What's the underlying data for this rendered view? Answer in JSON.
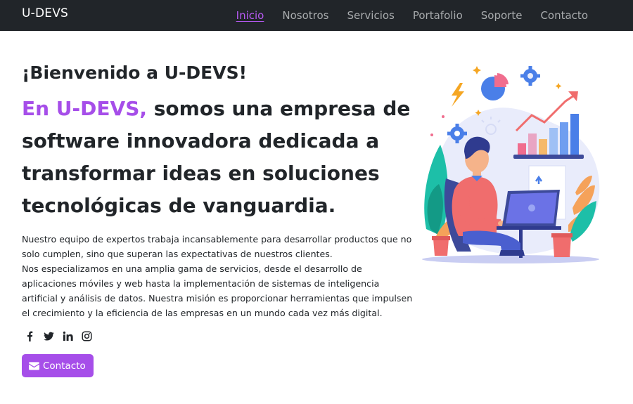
{
  "navbar": {
    "brand": "U-DEVS",
    "links": [
      {
        "label": "Inicio",
        "active": true
      },
      {
        "label": "Nosotros",
        "active": false
      },
      {
        "label": "Servicios",
        "active": false
      },
      {
        "label": "Portafolio",
        "active": false
      },
      {
        "label": "Soporte",
        "active": false
      },
      {
        "label": "Contacto",
        "active": false
      }
    ]
  },
  "hero": {
    "welcome": "¡Bienvenido a U-DEVS!",
    "headline_accent": "En U-DEVS,",
    "headline_rest": " somos una empresa de software innovadora dedicada a transformar ideas en soluciones tecnológicas de vanguardia.",
    "paragraph_1": "Nuestro equipo de expertos trabaja incansablemente para desarrollar productos que no solo cumplen, sino que superan las expectativas de nuestros clientes.",
    "paragraph_2": "Nos especializamos en una amplia gama de servicios, desde el desarrollo de aplicaciones móviles y web hasta la implementación de sistemas de inteligencia artificial y análisis de datos. Nuestra misión es proporcionar herramientas que impulsen el crecimiento y la eficiencia de las empresas en un mundo cada vez más digital.",
    "social_icons": [
      "facebook-icon",
      "twitter-icon",
      "linkedin-icon",
      "instagram-icon"
    ],
    "cta_label": "Contacto",
    "cta_icon": "envelope-icon"
  },
  "colors": {
    "navbar_bg": "#212529",
    "accent": "#a64ee9",
    "nav_link": "#a8abad",
    "text": "#212529"
  }
}
